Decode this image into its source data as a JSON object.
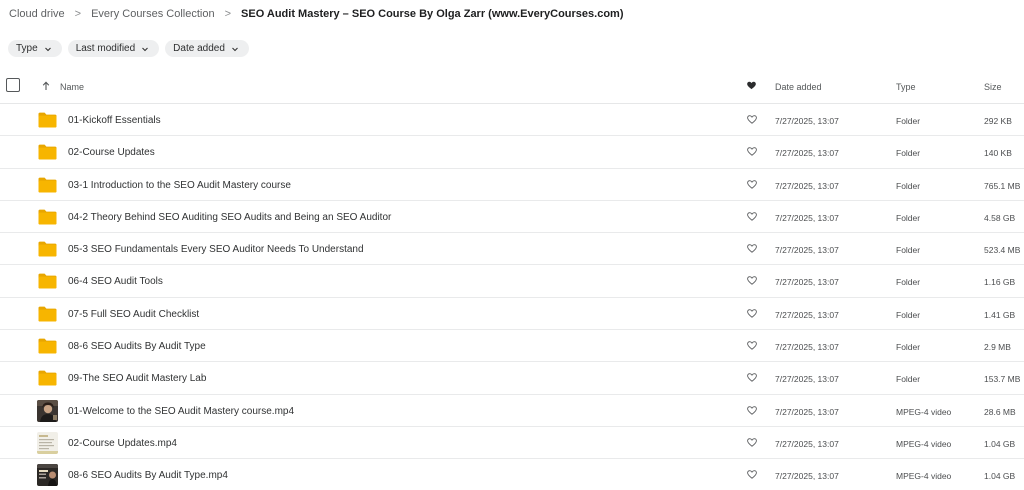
{
  "breadcrumb": {
    "items": [
      "Cloud drive",
      "Every Courses Collection"
    ],
    "current": "SEO Audit Mastery – SEO Course By Olga Zarr (www.EveryCourses.com)",
    "separator": ">"
  },
  "filters": [
    {
      "label": "Type",
      "icon": "chevron-down-icon"
    },
    {
      "label": "Last modified",
      "icon": "chevron-down-icon"
    },
    {
      "label": "Date added",
      "icon": "chevron-down-icon"
    }
  ],
  "table": {
    "columns": {
      "name": "Name",
      "date": "Date added",
      "type": "Type",
      "size": "Size"
    },
    "sort_icon": "arrow-up-icon",
    "favorite_header_icon": "heart-filled-icon",
    "rows": [
      {
        "kind": "folder",
        "name": "01-Kickoff Essentials",
        "date": "7/27/2025, 13:07",
        "type": "Folder",
        "size": "292 KB"
      },
      {
        "kind": "folder",
        "name": "02-Course Updates",
        "date": "7/27/2025, 13:07",
        "type": "Folder",
        "size": "140 KB"
      },
      {
        "kind": "folder",
        "name": "03-1 Introduction to the SEO Audit Mastery course",
        "date": "7/27/2025, 13:07",
        "type": "Folder",
        "size": "765.1 MB"
      },
      {
        "kind": "folder",
        "name": "04-2 Theory Behind SEO Auditing SEO Audits and Being an SEO Auditor",
        "date": "7/27/2025, 13:07",
        "type": "Folder",
        "size": "4.58 GB"
      },
      {
        "kind": "folder",
        "name": "05-3 SEO Fundamentals Every SEO Auditor Needs To Understand",
        "date": "7/27/2025, 13:07",
        "type": "Folder",
        "size": "523.4 MB"
      },
      {
        "kind": "folder",
        "name": "06-4 SEO Audit Tools",
        "date": "7/27/2025, 13:07",
        "type": "Folder",
        "size": "1.16 GB"
      },
      {
        "kind": "folder",
        "name": "07-5 Full SEO Audit Checklist",
        "date": "7/27/2025, 13:07",
        "type": "Folder",
        "size": "1.41 GB"
      },
      {
        "kind": "folder",
        "name": "08-6 SEO Audits By Audit Type",
        "date": "7/27/2025, 13:07",
        "type": "Folder",
        "size": "2.9 MB"
      },
      {
        "kind": "folder",
        "name": "09-The SEO Audit Mastery Lab",
        "date": "7/27/2025, 13:07",
        "type": "Folder",
        "size": "153.7 MB"
      },
      {
        "kind": "video",
        "thumb": "a",
        "name": "01-Welcome to the SEO Audit Mastery course.mp4",
        "date": "7/27/2025, 13:07",
        "type": "MPEG-4 video",
        "size": "28.6 MB"
      },
      {
        "kind": "video",
        "thumb": "b",
        "name": "02-Course Updates.mp4",
        "date": "7/27/2025, 13:07",
        "type": "MPEG-4 video",
        "size": "1.04 GB"
      },
      {
        "kind": "video",
        "thumb": "c",
        "name": "08-6 SEO Audits By Audit Type.mp4",
        "date": "7/27/2025, 13:07",
        "type": "MPEG-4 video",
        "size": "1.04 GB"
      }
    ]
  },
  "colors": {
    "folder": "#f7b500",
    "folder_tab": "#e8a600",
    "chip_bg": "#eeeff0",
    "text": "#303233"
  }
}
